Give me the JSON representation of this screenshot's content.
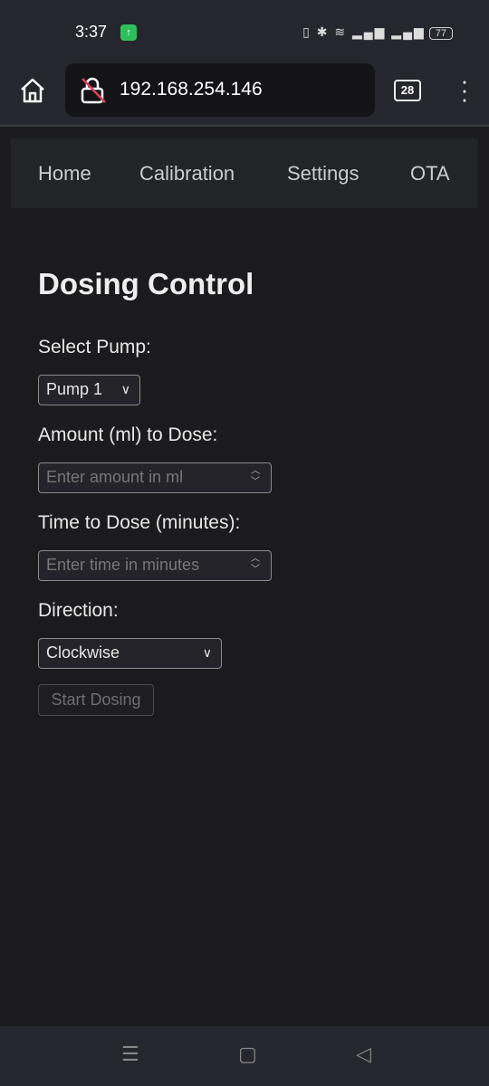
{
  "status_bar": {
    "time": "3:37",
    "battery": "77"
  },
  "browser": {
    "url": "192.168.254.146",
    "tab_count": "28"
  },
  "nav": {
    "items": [
      "Home",
      "Calibration",
      "Settings",
      "OTA"
    ]
  },
  "page": {
    "title": "Dosing Control",
    "pump_label": "Select Pump:",
    "pump_value": "Pump 1",
    "amount_label": "Amount (ml) to Dose:",
    "amount_placeholder": "Enter amount in ml",
    "time_label": "Time to Dose (minutes):",
    "time_placeholder": "Enter time in minutes",
    "direction_label": "Direction:",
    "direction_value": "Clockwise",
    "start_button": "Start Dosing"
  }
}
